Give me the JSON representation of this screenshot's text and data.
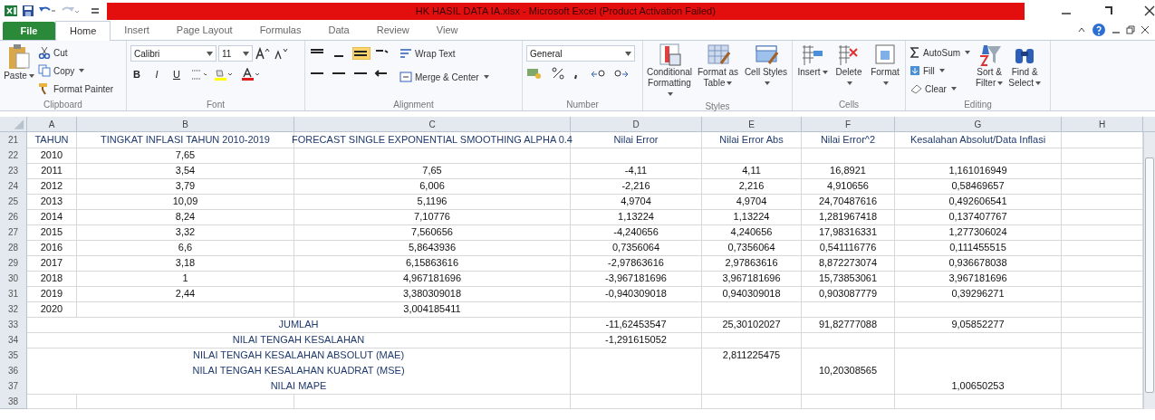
{
  "window": {
    "title": "HK HASIL DATA IA.xlsx - Microsoft Excel (Product Activation Failed)"
  },
  "tabs": [
    {
      "label": "File",
      "kind": "file",
      "selected": false
    },
    {
      "label": "Home",
      "kind": "tab",
      "selected": true
    },
    {
      "label": "Insert",
      "kind": "tab",
      "selected": false
    },
    {
      "label": "Page Layout",
      "kind": "tab",
      "selected": false
    },
    {
      "label": "Formulas",
      "kind": "tab",
      "selected": false
    },
    {
      "label": "Data",
      "kind": "tab",
      "selected": false
    },
    {
      "label": "Review",
      "kind": "tab",
      "selected": false
    },
    {
      "label": "View",
      "kind": "tab",
      "selected": false
    }
  ],
  "ribbon": {
    "clipboard": {
      "paste": "Paste",
      "cut": "Cut",
      "copy": "Copy",
      "format_painter": "Format Painter",
      "label": "Clipboard"
    },
    "font": {
      "name": "Calibri",
      "size": "11",
      "bold": "B",
      "italic": "I",
      "underline": "U",
      "label": "Font"
    },
    "alignment": {
      "wrap_text": "Wrap Text",
      "merge_center": "Merge & Center",
      "label": "Alignment"
    },
    "number": {
      "format": "General",
      "label": "Number"
    },
    "styles": {
      "buttons": [
        "Conditional Formatting",
        "Format as Table",
        "Cell Styles"
      ],
      "label": "Styles"
    },
    "cells": {
      "buttons": [
        "Insert",
        "Delete",
        "Format"
      ],
      "label": "Cells"
    },
    "editing": {
      "autosum": "AutoSum",
      "fill": "Fill",
      "clear": "Clear",
      "sort_filter": "Sort & Filter",
      "find_select": "Find & Select",
      "label": "Editing"
    }
  },
  "sheet": {
    "columns": [
      "A",
      "B",
      "C",
      "D",
      "E",
      "F",
      "G",
      "H"
    ],
    "rows": [
      {
        "number": "21",
        "kind": "data",
        "cells": {
          "A": "TAHUN",
          "B": "TINGKAT INFLASI TAHUN 2010-2019",
          "C": "FORECAST SINGLE EXPONENTIAL SMOOTHING ALPHA 0.4",
          "D": "Nilai Error",
          "E": "Nilai Error Abs",
          "F": "Nilai Error^2",
          "G": "Kesalahan Absolut/Data Inflasi"
        }
      },
      {
        "number": "22",
        "kind": "data",
        "cells": {
          "A": "2010",
          "B": "7,65"
        }
      },
      {
        "number": "23",
        "kind": "data",
        "cells": {
          "A": "2011",
          "B": "3,54",
          "C": "7,65",
          "D": "-4,11",
          "E": "4,11",
          "F": "16,8921",
          "G": "1,161016949"
        }
      },
      {
        "number": "24",
        "kind": "data",
        "cells": {
          "A": "2012",
          "B": "3,79",
          "C": "6,006",
          "D": "-2,216",
          "E": "2,216",
          "F": "4,910656",
          "G": "0,58469657"
        }
      },
      {
        "number": "25",
        "kind": "data",
        "cells": {
          "A": "2013",
          "B": "10,09",
          "C": "5,1196",
          "D": "4,9704",
          "E": "4,9704",
          "F": "24,70487616",
          "G": "0,492606541"
        }
      },
      {
        "number": "26",
        "kind": "data",
        "cells": {
          "A": "2014",
          "B": "8,24",
          "C": "7,10776",
          "D": "1,13224",
          "E": "1,13224",
          "F": "1,281967418",
          "G": "0,137407767"
        }
      },
      {
        "number": "27",
        "kind": "data",
        "cells": {
          "A": "2015",
          "B": "3,32",
          "C": "7,560656",
          "D": "-4,240656",
          "E": "4,240656",
          "F": "17,98316331",
          "G": "1,277306024"
        }
      },
      {
        "number": "28",
        "kind": "data",
        "cells": {
          "A": "2016",
          "B": "6,6",
          "C": "5,8643936",
          "D": "0,7356064",
          "E": "0,7356064",
          "F": "0,541116776",
          "G": "0,111455515"
        }
      },
      {
        "number": "29",
        "kind": "data",
        "cells": {
          "A": "2017",
          "B": "3,18",
          "C": "6,15863616",
          "D": "-2,97863616",
          "E": "2,97863616",
          "F": "8,872273074",
          "G": "0,936678038"
        }
      },
      {
        "number": "30",
        "kind": "data",
        "cells": {
          "A": "2018",
          "B": "1",
          "C": "4,967181696",
          "D": "-3,967181696",
          "E": "3,967181696",
          "F": "15,73853061",
          "G": "3,967181696"
        }
      },
      {
        "number": "31",
        "kind": "data",
        "cells": {
          "A": "2019",
          "B": "2,44",
          "C": "3,380309018",
          "D": "-0,940309018",
          "E": "0,940309018",
          "F": "0,903087779",
          "G": "0,39296271"
        }
      },
      {
        "number": "32",
        "kind": "data",
        "cells": {
          "A": "2020",
          "C": "3,004185411"
        }
      },
      {
        "number": "33",
        "kind": "summary",
        "label": "JUMLAH",
        "cells": {
          "D": "-11,62453547",
          "E": "25,30102027",
          "F": "91,82777088",
          "G": "9,05852277"
        }
      },
      {
        "number": "34",
        "kind": "summary",
        "label": "NILAI TENGAH KESALAHAN",
        "cells": {
          "D": "-1,291615052"
        }
      },
      {
        "number": "35",
        "kind": "summary_stack",
        "label": "NILAI TENGAH KESALAHAN ABSOLUT (MAE)",
        "cells": {
          "E": "2,811225475"
        }
      },
      {
        "number": "36",
        "kind": "summary_stack",
        "label": "NILAI TENGAH KESALAHAN KUADRAT (MSE)",
        "cells": {
          "F": "10,20308565"
        }
      },
      {
        "number": "37",
        "kind": "summary_stack",
        "label": "NILAI MAPE",
        "cells": {
          "G": "1,00650253"
        }
      },
      {
        "number": "38",
        "kind": "data",
        "cells": {}
      }
    ]
  }
}
